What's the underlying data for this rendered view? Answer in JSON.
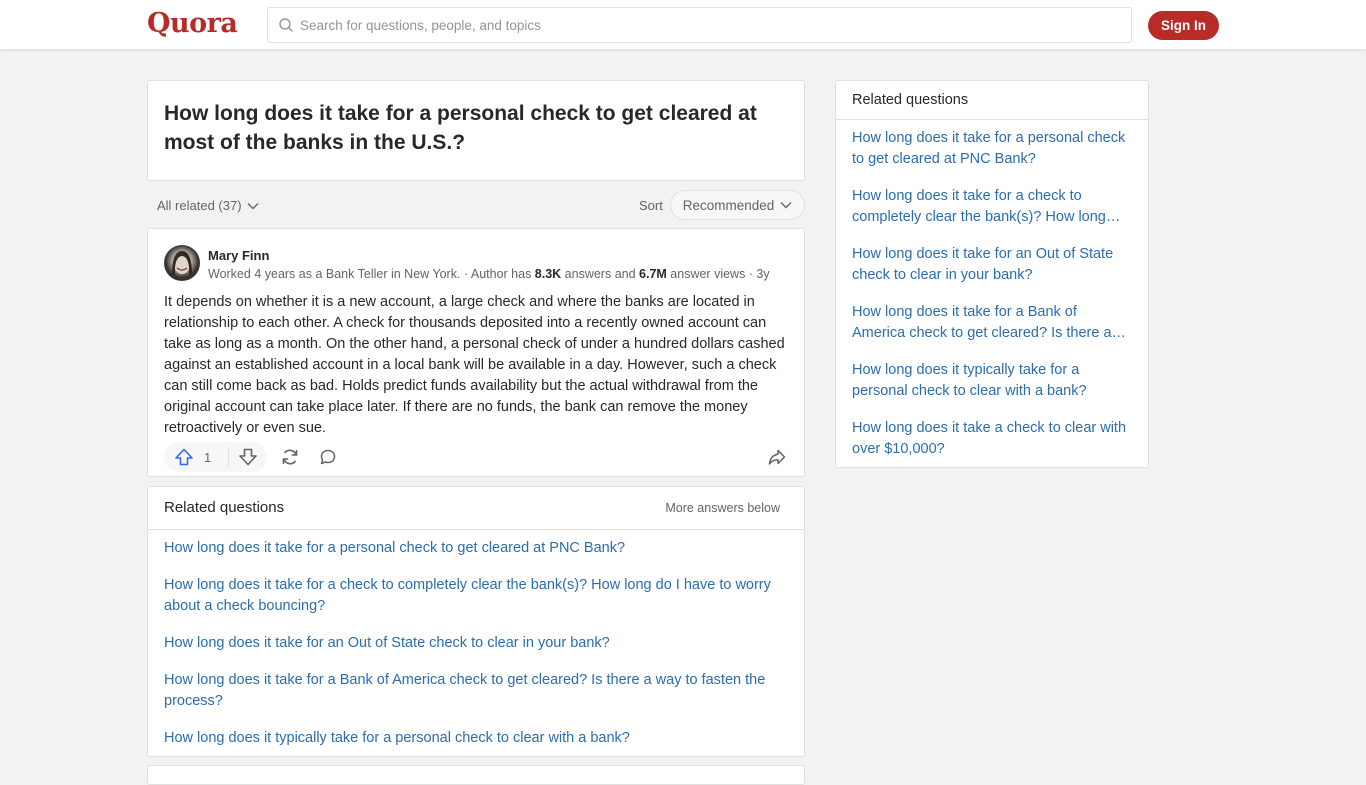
{
  "header": {
    "logo": "Quora",
    "search_placeholder": "Search for questions, people, and topics",
    "sign_in_label": "Sign In",
    "brand_color": "#b92b27"
  },
  "question": {
    "title": "How long does it take for a personal check to get cleared at most of the banks in the U.S.?"
  },
  "filters": {
    "all_related_label": "All related (37)",
    "sort_label": "Sort",
    "sort_value": "Recommended"
  },
  "answer": {
    "author_name": "Mary Finn",
    "credential_prefix": "Worked 4 years as a Bank Teller in New York. · Author has ",
    "answers_count": "8.3K",
    "credential_mid": " answers and ",
    "views_count": "6.7M",
    "credential_suffix": " answer views · 3y",
    "text": "It depends on whether it is a new account, a large check and where the banks are located in relationship to each other. A check for thousands deposited into a recently owned account can take as long as a month. On the other hand, a personal check of under a hundred dollars cashed against an established account in a local bank will be available in a day. However, such a check can still come back as bad. Holds predict funds availability but the actual withdrawal from the original account can take place later. If there are no funds, the bank can remove the money retroactively or even sue.",
    "upvotes": "1",
    "icons": [
      "upvote-icon",
      "downvote-icon",
      "share-rotate-icon",
      "comment-icon",
      "share-arrow-icon"
    ]
  },
  "related_inline": {
    "title": "Related questions",
    "more_label": "More answers below",
    "items": [
      "How long does it take for a personal check to get cleared at PNC Bank?",
      "How long does it take for a check to completely clear the bank(s)? How long do I have to worry about a check bouncing?",
      "How long does it take for an Out of State check to clear in your bank?",
      "How long does it take for a Bank of America check to get cleared? Is there a way to fasten the process?",
      "How long does it typically take for a personal check to clear with a bank?"
    ]
  },
  "related_sidebar": {
    "title": "Related questions",
    "items": [
      "How long does it take for a personal check to get cleared at PNC Bank?",
      "How long does it take for a check to completely clear the bank(s)? How long…",
      "How long does it take for an Out of State check to clear in your bank?",
      "How long does it take for a Bank of America check to get cleared? Is there a…",
      "How long does it typically take for a personal check to clear with a bank?",
      "How long does it take a check to clear with over $10,000?"
    ]
  }
}
